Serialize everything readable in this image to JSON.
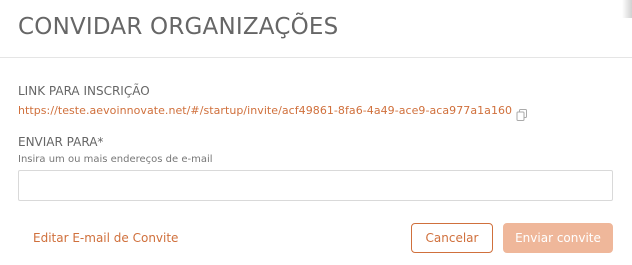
{
  "modal": {
    "title": "CONVIDAR ORGANIZAÇÕES"
  },
  "link_section": {
    "label": "LINK PARA INSCRIÇÃO",
    "url": "https://teste.aevoinnovate.net/#/startup/invite/acf49861-8fa6-4a49-ace9-aca977a1a160",
    "copy_icon": "copy-icon"
  },
  "send_section": {
    "label": "ENVIAR PARA*",
    "hint": "Insira um ou mais endereços de e-mail",
    "email_value": "",
    "email_placeholder": ""
  },
  "footer": {
    "edit_email_label": "Editar E-mail de Convite",
    "cancel_label": "Cancelar",
    "send_label": "Enviar convite"
  },
  "colors": {
    "accent": "#d0703c",
    "accent_disabled": "#efb79a",
    "text": "#666666",
    "border": "#d9d9d9"
  }
}
